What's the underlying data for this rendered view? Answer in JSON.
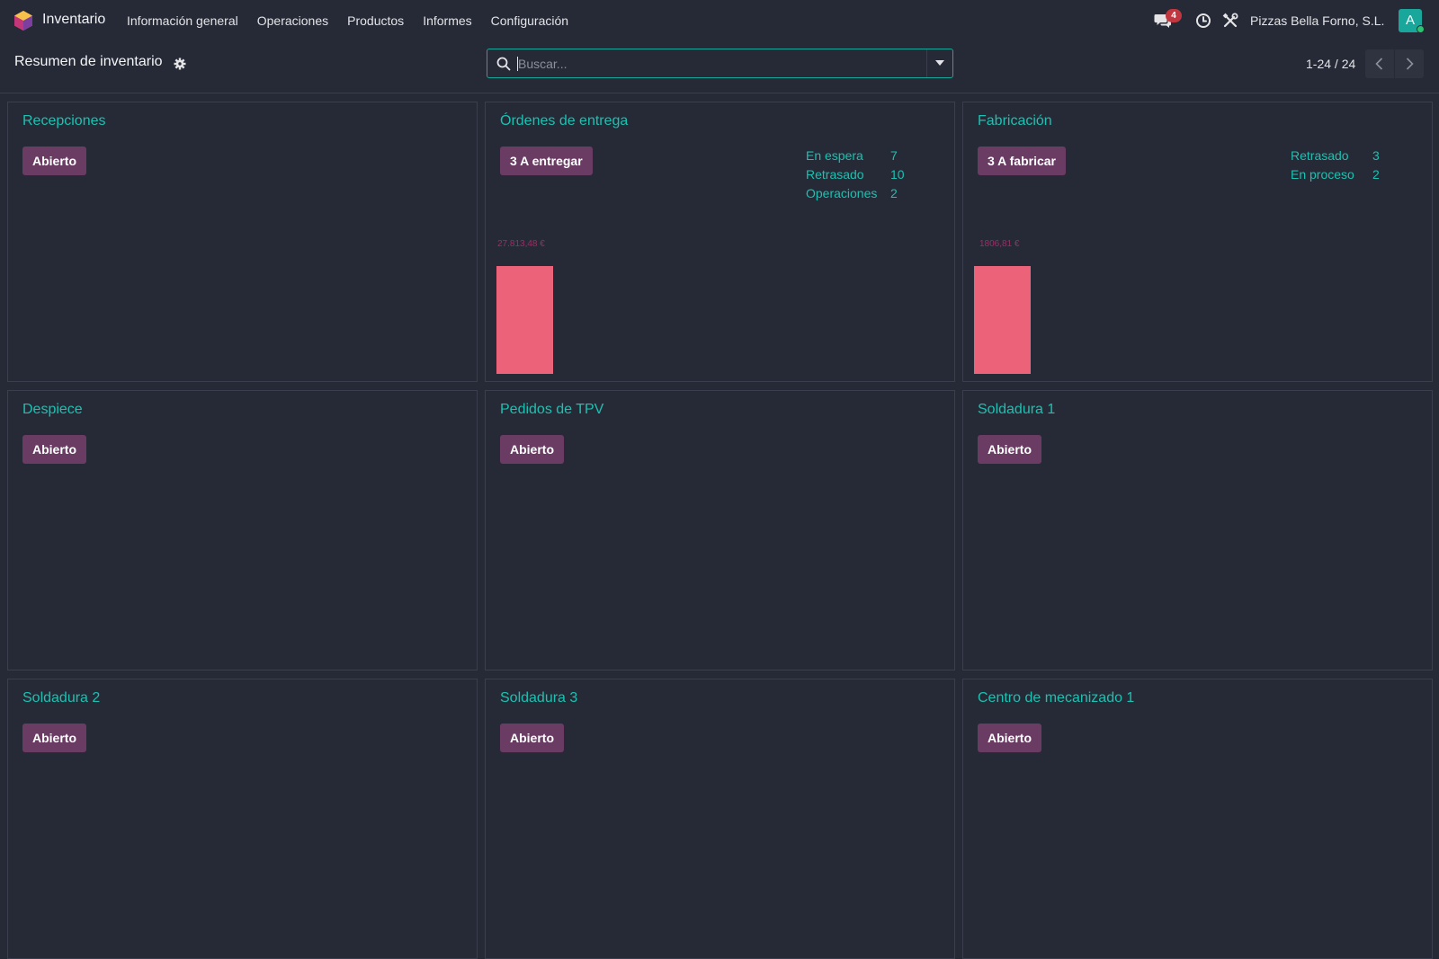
{
  "navbar": {
    "app_name": "Inventario",
    "menu": [
      "Información general",
      "Operaciones",
      "Productos",
      "Informes",
      "Configuración"
    ],
    "chat_count": "4",
    "company": "Pizzas Bella Forno, S.L.",
    "avatar_letter": "A"
  },
  "control_panel": {
    "breadcrumb": "Resumen de inventario",
    "search_placeholder": "Buscar...",
    "pager": "1-24 / 24"
  },
  "colors": {
    "accent": "#1bc1b1",
    "button": "#6a3c64",
    "bar": "#ec6278",
    "badge": "#c2363f"
  },
  "cards": [
    {
      "title": "Recepciones",
      "button": "Abierto"
    },
    {
      "title": "Órdenes de entrega",
      "button": "3 A entregar",
      "stats": [
        {
          "label": "En espera",
          "value": "7"
        },
        {
          "label": "Retrasado",
          "value": "10"
        },
        {
          "label": "Operaciones",
          "value": "2"
        }
      ],
      "graph": {
        "label": "27.813,48 €",
        "fill": 1.0
      }
    },
    {
      "title": "Fabricación",
      "button": "3 A fabricar",
      "stats": [
        {
          "label": "Retrasado",
          "value": "3"
        },
        {
          "label": "En proceso",
          "value": "2"
        }
      ],
      "graph": {
        "label": "1806,81 €",
        "fill": 1.0
      }
    },
    {
      "title": "Despiece",
      "button": "Abierto"
    },
    {
      "title": "Pedidos de TPV",
      "button": "Abierto"
    },
    {
      "title": "Soldadura 1",
      "button": "Abierto"
    },
    {
      "title": "Soldadura 2",
      "button": "Abierto"
    },
    {
      "title": "Soldadura 3",
      "button": "Abierto"
    },
    {
      "title": "Centro de mecanizado 1",
      "button": "Abierto"
    }
  ]
}
